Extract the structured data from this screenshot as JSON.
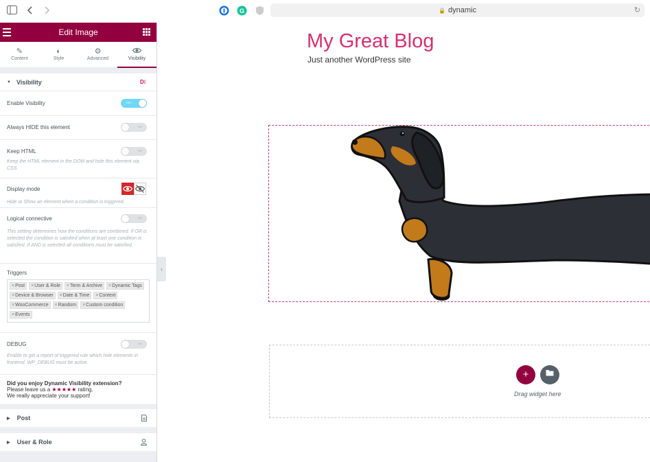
{
  "browser": {
    "url": "dynamic"
  },
  "panel": {
    "title": "Edit Image",
    "tabs": [
      {
        "label": "Content",
        "icon": "pencil-icon"
      },
      {
        "label": "Style",
        "icon": "contrast-icon"
      },
      {
        "label": "Advanced",
        "icon": "gear-icon"
      },
      {
        "label": "Visibility",
        "icon": "eye-icon"
      }
    ],
    "active_tab": "Visibility",
    "section_title": "Visibility",
    "enable_visibility": {
      "label": "Enable Visibility",
      "state": "YES"
    },
    "always_hide": {
      "label": "Always HIDE this element",
      "state": "NO"
    },
    "keep_html": {
      "label": "Keep HTML",
      "state": "NO",
      "desc": "Keep the HTML element in the DOM and hide this element via CSS."
    },
    "display_mode": {
      "label": "Display mode",
      "desc": "Hide or Show an element when a condition is triggered."
    },
    "logical_connective": {
      "label": "Logical connective",
      "state": "OR",
      "desc": "This setting determines how the conditions are combined. If OR is selected the condition is satisfied when at least one condition is satisfied. If AND is selected all conditions must be satisfied."
    },
    "triggers": {
      "label": "Triggers",
      "tags": [
        "Post",
        "User & Role",
        "Term & Archive",
        "Dynamic Tags",
        "Device & Browser",
        "Date & Time",
        "Context",
        "WooCommerce",
        "Random",
        "Custom condition",
        "Events"
      ]
    },
    "debug": {
      "label": "DEBUG",
      "state": "NO",
      "desc": "Enable to get a report of triggered rule which hide elements in frontend. WP_DEBUG must be active."
    },
    "promo": {
      "line1": "Did you enjoy Dynamic Visibility extension?",
      "line2_pre": "Please leave us a ",
      "stars": "★★★★★",
      "line2_post": " rating.",
      "line3": "We really appreciate your support!"
    },
    "collapsed_sections": [
      {
        "label": "Post",
        "icon": "document-icon"
      },
      {
        "label": "User & Role",
        "icon": "user-icon"
      }
    ]
  },
  "preview": {
    "site_title": "My Great Blog",
    "tagline": "Just another WordPress site",
    "drop_text": "Drag widget here",
    "add_symbol": "+"
  }
}
